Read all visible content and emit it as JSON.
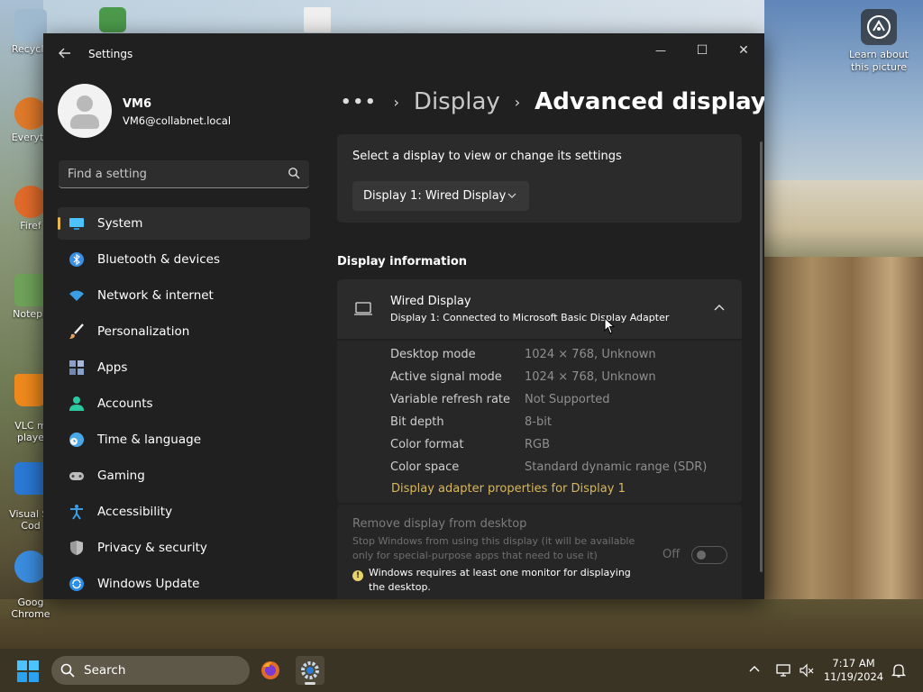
{
  "desktop": {
    "icons": [
      {
        "label": "Recycle",
        "color": "#9fb9cf"
      },
      {
        "label": "Everyth",
        "color": "#e07a2a"
      },
      {
        "label": "Firef",
        "color": "#e26b2a"
      },
      {
        "label": "Notepa",
        "color": "#6fa35a"
      },
      {
        "label": "VLC m\nplaye",
        "color": "#f08a1c"
      },
      {
        "label": "Visual St\nCod",
        "color": "#2a7ad6"
      },
      {
        "label": "Goog\nChrome",
        "color": "#3b8de0"
      }
    ],
    "learn_label": "Learn about this picture"
  },
  "window": {
    "app_title": "Settings",
    "controls": {
      "minimize": "—",
      "maximize": "☐",
      "close": "✕"
    }
  },
  "profile": {
    "name": "VM6",
    "email": "VM6@collabnet.local"
  },
  "search": {
    "placeholder": "Find a setting"
  },
  "nav": {
    "items": [
      {
        "label": "System",
        "icon": "system-icon",
        "color": "#4cc2ff"
      },
      {
        "label": "Bluetooth & devices",
        "icon": "bluetooth-icon",
        "color": "#3a8ee6"
      },
      {
        "label": "Network & internet",
        "icon": "wifi-icon",
        "color": "#3a9ee6"
      },
      {
        "label": "Personalization",
        "icon": "brush-icon",
        "color": "#e0a060"
      },
      {
        "label": "Apps",
        "icon": "apps-icon",
        "color": "#8aa0c8"
      },
      {
        "label": "Accounts",
        "icon": "accounts-icon",
        "color": "#2cc9a0"
      },
      {
        "label": "Time & language",
        "icon": "time-language-icon",
        "color": "#4aa8e6"
      },
      {
        "label": "Gaming",
        "icon": "gaming-icon",
        "color": "#bdbdbd"
      },
      {
        "label": "Accessibility",
        "icon": "accessibility-icon",
        "color": "#3a9ee6"
      },
      {
        "label": "Privacy & security",
        "icon": "shield-icon",
        "color": "#9a9a9a"
      },
      {
        "label": "Windows Update",
        "icon": "update-icon",
        "color": "#2a8ee6"
      }
    ],
    "active_index": 0,
    "accent_color": "#e8b84a"
  },
  "breadcrumb": {
    "more": "•••",
    "parent": "Display",
    "current": "Advanced display"
  },
  "select_display": {
    "prompt": "Select a display to view or change its settings",
    "selected": "Display 1: Wired Display"
  },
  "display_info": {
    "section_title": "Display information",
    "title": "Wired Display",
    "subtitle": "Display 1: Connected to Microsoft Basic Display Adapter",
    "rows": [
      {
        "label": "Desktop mode",
        "value": "1024 × 768, Unknown"
      },
      {
        "label": "Active signal mode",
        "value": "1024 × 768, Unknown"
      },
      {
        "label": "Variable refresh rate",
        "value": "Not Supported"
      },
      {
        "label": "Bit depth",
        "value": "8-bit"
      },
      {
        "label": "Color format",
        "value": "RGB"
      },
      {
        "label": "Color space",
        "value": "Standard dynamic range (SDR)"
      }
    ],
    "adapter_link": "Display adapter properties for Display 1"
  },
  "remove_display": {
    "title": "Remove display from desktop",
    "description": "Stop Windows from using this display (it will be available only for special-purpose apps that need to use it)",
    "warning": "Windows requires at least one monitor for displaying the desktop.",
    "toggle_state": "Off"
  },
  "taskbar": {
    "search_label": "Search",
    "time": "7:17 AM",
    "date": "11/19/2024"
  }
}
